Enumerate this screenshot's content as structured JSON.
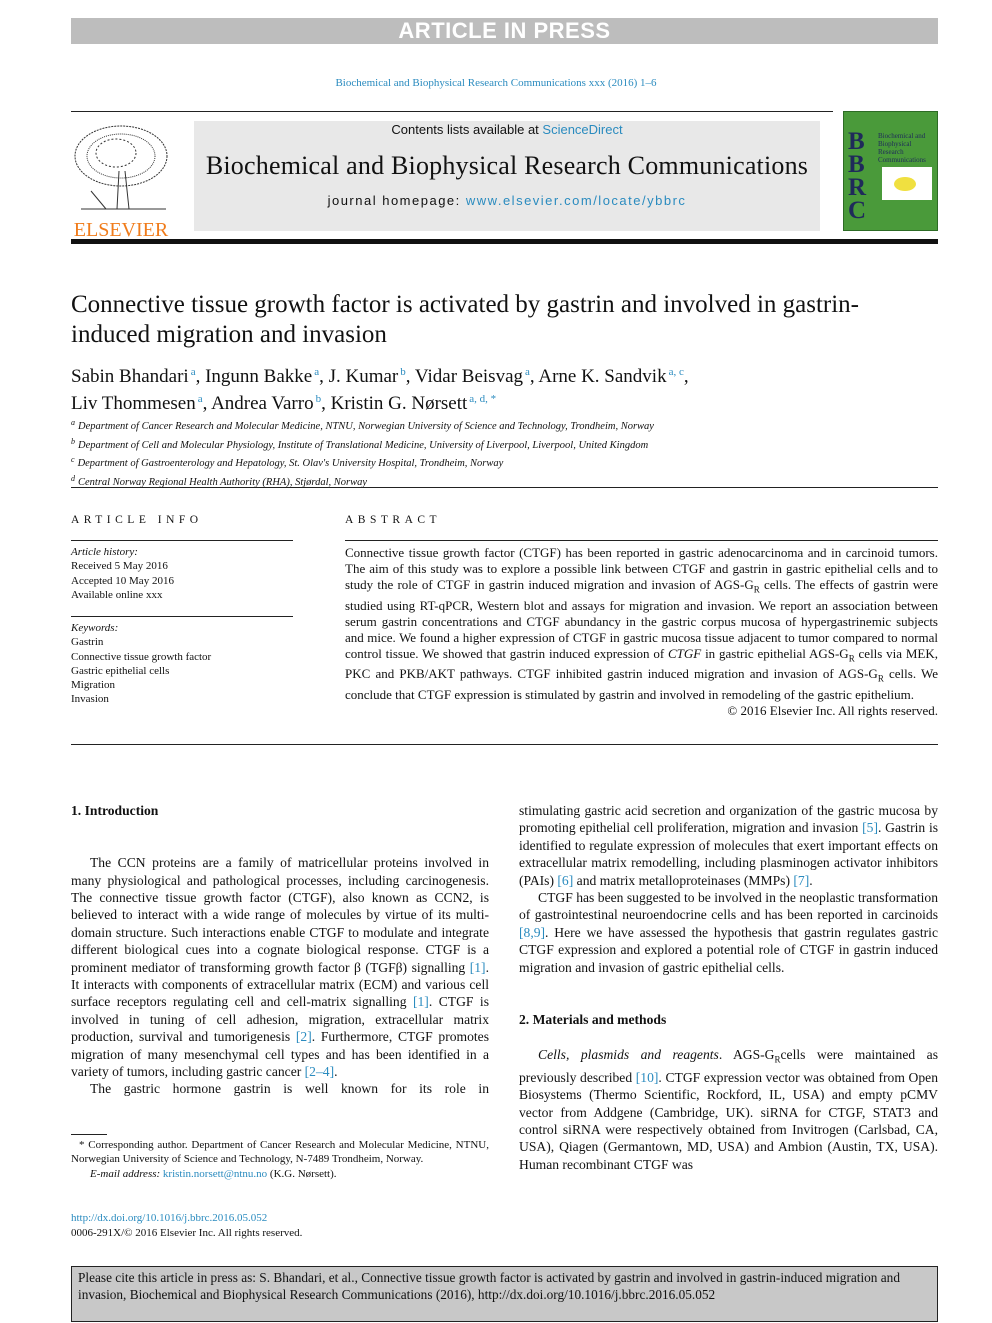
{
  "banner_top": "ARTICLE IN PRESS",
  "journal_ref": "Biochemical and Biophysical Research Communications xxx (2016) 1–6",
  "header": {
    "contents_prefix": "Contents lists available at ",
    "contents_link": "ScienceDirect",
    "journal_title": "Biochemical and Biophysical Research Communications",
    "homepage_prefix": "journal homepage: ",
    "homepage_link": "www.elsevier.com/locate/ybbrc",
    "publisher_logo": "ELSEVIER",
    "cover_letters": [
      "B",
      "B",
      "R",
      "C"
    ],
    "cover_title": "Biochemical and Biophysical Research Communications"
  },
  "colors": {
    "link": "#2a8bbf",
    "elsevier_orange": "#f07c1b",
    "cover_green": "#4a9a3a",
    "banner_gray": "#bdbdbd"
  },
  "title": "Connective tissue growth factor is activated by gastrin and involved in gastrin-induced migration and invasion",
  "authors": [
    {
      "name": "Sabin Bhandari",
      "sup": "a"
    },
    {
      "name": "Ingunn Bakke",
      "sup": "a"
    },
    {
      "name": "J. Kumar",
      "sup": "b"
    },
    {
      "name": "Vidar Beisvag",
      "sup": "a"
    },
    {
      "name": "Arne K. Sandvik",
      "sup": "a, c"
    },
    {
      "name": "Liv Thommesen",
      "sup": "a"
    },
    {
      "name": "Andrea Varro",
      "sup": "b"
    },
    {
      "name": "Kristin G. Nørsett",
      "sup": "a, d, *"
    }
  ],
  "affiliations": [
    {
      "key": "a",
      "text": "Department of Cancer Research and Molecular Medicine, NTNU, Norwegian University of Science and Technology, Trondheim, Norway"
    },
    {
      "key": "b",
      "text": "Department of Cell and Molecular Physiology, Institute of Translational Medicine, University of Liverpool, Liverpool, United Kingdom"
    },
    {
      "key": "c",
      "text": "Department of Gastroenterology and Hepatology, St. Olav's University Hospital, Trondheim, Norway"
    },
    {
      "key": "d",
      "text": "Central Norway Regional Health Authority (RHA), Stjørdal, Norway"
    }
  ],
  "article_info": {
    "heading": "ARTICLE INFO",
    "history_label": "Article history:",
    "history": [
      "Received 5 May 2016",
      "Accepted 10 May 2016",
      "Available online xxx"
    ],
    "keywords_label": "Keywords:",
    "keywords": [
      "Gastrin",
      "Connective tissue growth factor",
      "Gastric epithelial cells",
      "Migration",
      "Invasion"
    ]
  },
  "abstract": {
    "heading": "ABSTRACT",
    "segments": [
      [
        "Connective tissue growth factor (CTGF) has been reported in gastric adenocarcinoma and in carcinoid tumors. The aim of this study was to explore a possible link between CTGF and gastrin in gastric epithelial cells and to study the role of CTGF in gastrin induced migration and invasion of AGS-G",
        ""
      ],
      [
        "R",
        "sub"
      ],
      [
        " cells. The effects of gastrin were studied using RT-qPCR, Western blot and assays for migration and invasion. We report an association between serum gastrin concentrations and CTGF abundancy in the gastric corpus mucosa of hypergastrinemic subjects and mice. We found a higher expression of CTGF in gastric mucosa tissue adjacent to tumor compared to normal control tissue. We showed that gastrin induced expression of ",
        ""
      ],
      [
        "CTGF",
        "i"
      ],
      [
        " in gastric epithelial AGS-G",
        ""
      ],
      [
        "R",
        "sub"
      ],
      [
        " cells via MEK, PKC and PKB/AKT pathways. CTGF inhibited gastrin induced migration and invasion of AGS-G",
        ""
      ],
      [
        "R",
        "sub"
      ],
      [
        " cells. We conclude that CTGF expression is stimulated by gastrin and involved in remodeling of the gastric epithelium.",
        ""
      ]
    ],
    "copyright": "© 2016 Elsevier Inc. All rights reserved."
  },
  "intro": {
    "heading": "1.  Introduction",
    "paragraphs": [
      [
        [
          "The CCN proteins are a family of matricellular proteins involved in many physiological and pathological processes, including carcinogenesis. The connective tissue growth factor (CTGF), also known as CCN2, is believed to interact with a wide range of molecules by virtue of its multi-domain structure. Such interactions enable CTGF to modulate and integrate different biological cues into a cognate biological response. CTGF is a prominent mediator of transforming growth factor β (TGFβ) signalling ",
          ""
        ],
        [
          "[1]",
          "ref"
        ],
        [
          ". It interacts with components of extracellular matrix (ECM) and various cell surface receptors regulating cell and cell-matrix signalling ",
          ""
        ],
        [
          "[1]",
          "ref"
        ],
        [
          ". CTGF is involved in tuning of cell adhesion, migration, extracellular matrix production, survival and tumorigenesis ",
          ""
        ],
        [
          "[2]",
          "ref"
        ],
        [
          ". Furthermore, CTGF promotes migration of many mesenchymal cell types and has been identified in a variety of tumors, including gastric cancer ",
          ""
        ],
        [
          "[2–4]",
          "ref"
        ],
        [
          ".",
          ""
        ]
      ],
      [
        [
          "The gastric hormone gastrin is well known for its role in stimulating gastric acid secretion and organization of the gastric mucosa by promoting epithelial cell proliferation, migration and invasion ",
          ""
        ],
        [
          "[5]",
          "ref"
        ],
        [
          ". Gastrin is identified to regulate expression of molecules that exert important effects on extracellular matrix remodelling, including plasminogen activator inhibitors (PAIs) ",
          ""
        ],
        [
          "[6]",
          "ref"
        ],
        [
          " and matrix metalloproteinases (MMPs) ",
          ""
        ],
        [
          "[7]",
          "ref"
        ],
        [
          ".",
          ""
        ]
      ],
      [
        [
          "CTGF has been suggested to be involved in the neoplastic transformation of gastrointestinal neuroendocrine cells and has been reported in carcinoids ",
          ""
        ],
        [
          "[8,9]",
          "ref"
        ],
        [
          ". Here we have assessed the hypothesis that gastrin regulates gastric CTGF expression and explored a potential role of CTGF in gastrin induced migration and invasion of gastric epithelial cells.",
          ""
        ]
      ]
    ]
  },
  "methods": {
    "heading": "2.  Materials and methods",
    "paragraphs": [
      [
        [
          "Cells, plasmids and reagents",
          "i"
        ],
        [
          ". AGS-G",
          ""
        ],
        [
          "R",
          "sub"
        ],
        [
          "cells were maintained as previously described ",
          ""
        ],
        [
          "[10]",
          "ref"
        ],
        [
          ". CTGF expression vector was obtained from Open Biosystems (Thermo Scientific, Rockford, IL, USA) and empty pCMV vector from Addgene (Cambridge, UK). siRNA for CTGF, STAT3 and control siRNA were respectively obtained from Invitrogen (Carlsbad, CA, USA), Qiagen (Germantown, MD, USA) and Ambion (Austin, TX, USA). Human recombinant CTGF was",
          ""
        ]
      ]
    ]
  },
  "footnote": {
    "text": "* Corresponding author. Department of Cancer Research and Molecular Medicine, NTNU, Norwegian University of Science and Technology, N-7489 Trondheim, Norway.",
    "email_label": "E-mail address: ",
    "email": "kristin.norsett@ntnu.no",
    "email_suffix": " (K.G. Nørsett)."
  },
  "doi": "http://dx.doi.org/10.1016/j.bbrc.2016.05.052",
  "issn": "0006-291X/© 2016 Elsevier Inc. All rights reserved.",
  "citation": "Please cite this article in press as: S. Bhandari, et al., Connective tissue growth factor is activated by gastrin and involved in gastrin-induced migration and invasion, Biochemical and Biophysical Research Communications (2016), http://dx.doi.org/10.1016/j.bbrc.2016.05.052"
}
